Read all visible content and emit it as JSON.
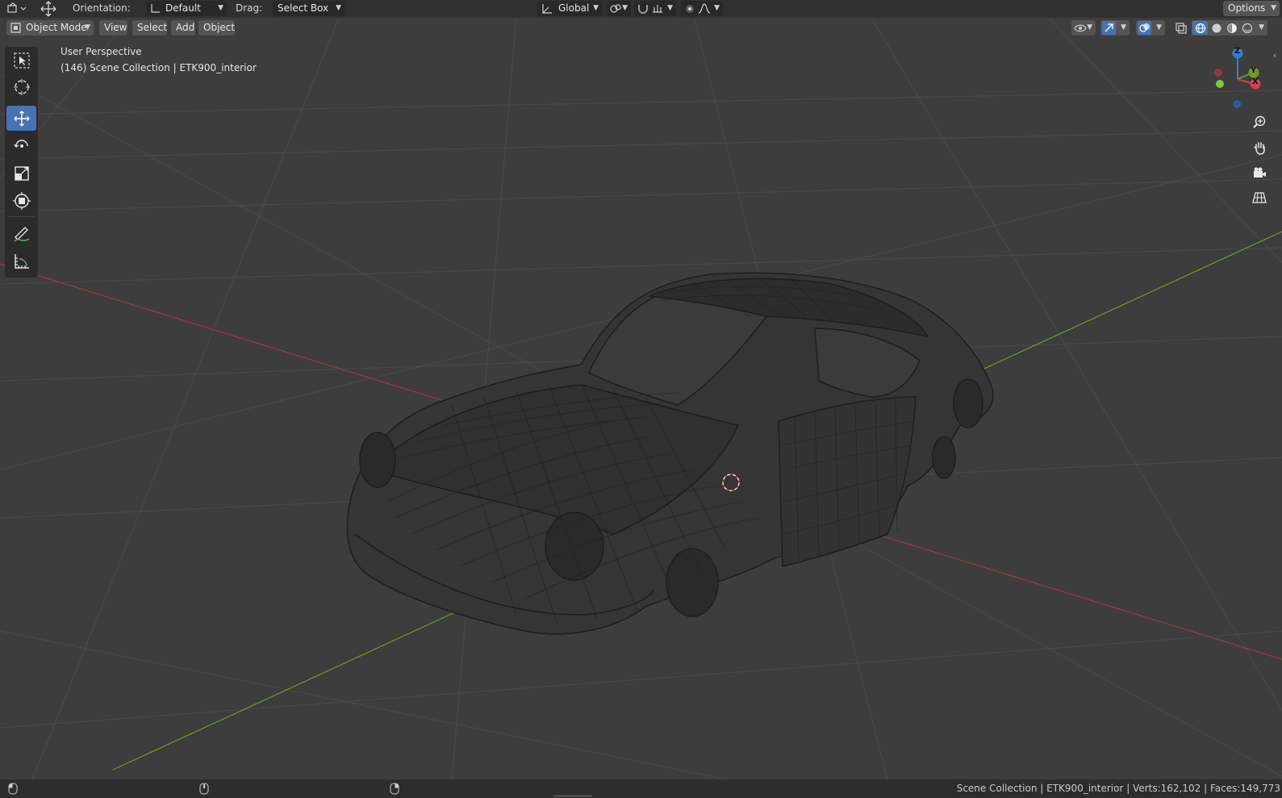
{
  "tool_header": {
    "orientation_label": "Orientation:",
    "orientation_value": "Default",
    "drag_label": "Drag:",
    "drag_value": "Select Box",
    "transform_orientation": "Global",
    "options_label": "Options"
  },
  "viewport_header": {
    "mode": "Object Mode",
    "menus": [
      "View",
      "Select",
      "Add",
      "Object"
    ]
  },
  "overlay": {
    "view_name": "User Perspective",
    "scene_info": "(146) Scene Collection | ETK900_interior"
  },
  "gizmo": {
    "z_label": "Z",
    "y_label": "Y",
    "x_label": "X"
  },
  "status_bar": {
    "stats": "Scene Collection | ETK900_interior | Verts:162,102 | Faces:149,773"
  },
  "colors": {
    "active_tool": "#4772b3",
    "axis_x": "#b63b49",
    "axis_y": "#6e9a2e",
    "axis_z": "#2f7fd6",
    "background": "#3d3d3d"
  }
}
